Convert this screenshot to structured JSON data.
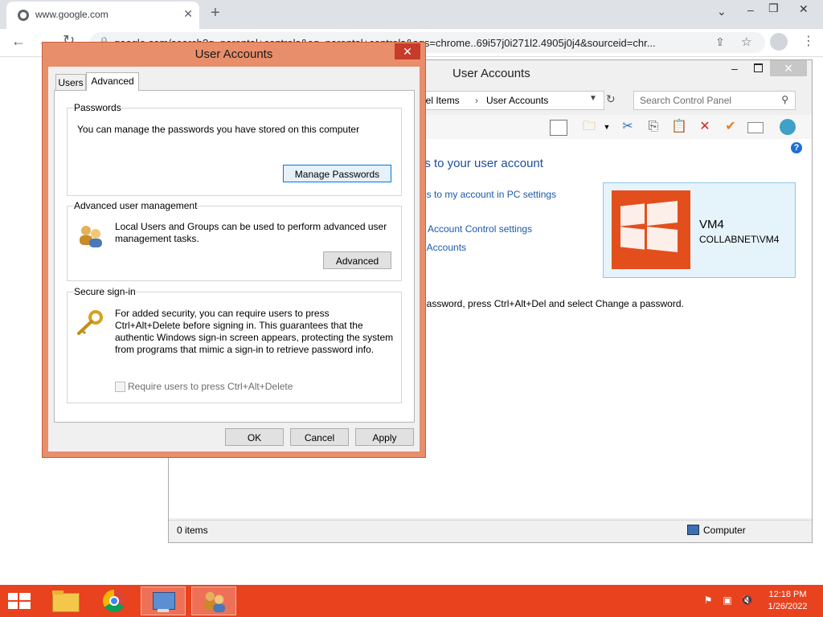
{
  "browser": {
    "tab_title": "www.google.com",
    "tab_close": "✕",
    "new_tab": "+",
    "url": "google.com/search?q=parental+controls&oq=parental+controls&aqs=chrome..69i57j0i271l2.4905j0j4&sourceid=chr...",
    "window_controls": {
      "minimize": "–",
      "restore": "❐",
      "close": "✕"
    },
    "chevron": "⌄",
    "icons": [
      "back-icon",
      "forward-icon",
      "reload-icon",
      "share-icon",
      "bookmark-star-icon",
      "profile-icon",
      "menu-icon"
    ]
  },
  "control_panel": {
    "title": "User Accounts",
    "close_glyph": "✕",
    "min_glyph": "–",
    "breadcrumb": [
      "nel Items",
      "User Accounts"
    ],
    "breadcrumb_sep": "›",
    "search_placeholder": "Search Control Panel",
    "help_glyph": "?",
    "heading": "es to your user account",
    "links": [
      "es to my account in PC settings",
      "Account Control settings",
      "r Accounts"
    ],
    "user": {
      "name": "VM4",
      "domain": "COLLABNET\\VM4"
    },
    "note": "password, press Ctrl+Alt+Del and select Change a password.",
    "status": {
      "items": "0 items",
      "location": "Computer"
    }
  },
  "dialog": {
    "title": "User Accounts",
    "close_glyph": "✕",
    "tabs": [
      {
        "label": "Users",
        "active": false
      },
      {
        "label": "Advanced",
        "active": true
      }
    ],
    "passwords": {
      "label": "Passwords",
      "text": "You can manage the passwords you have stored on this computer",
      "button": "Manage Passwords"
    },
    "advanced_mgmt": {
      "label": "Advanced user management",
      "text": "Local Users and Groups can be used to perform advanced user management tasks.",
      "button": "Advanced"
    },
    "secure_signin": {
      "label": "Secure sign-in",
      "text": "For added security, you can require users to press Ctrl+Alt+Delete before signing in. This guarantees that the authentic Windows sign-in screen appears, protecting the system from programs that mimic a sign-in to retrieve password info.",
      "checkbox_label": "Require users to press Ctrl+Alt+Delete",
      "checkbox_checked": false,
      "checkbox_enabled": false
    },
    "buttons": {
      "ok": "OK",
      "cancel": "Cancel",
      "apply": "Apply"
    }
  },
  "taskbar": {
    "apps": [
      "file-explorer-icon",
      "chrome-icon",
      "control-panel-icon",
      "user-accounts-icon"
    ],
    "active_app": "user-accounts-icon",
    "time": "12:18 PM",
    "date": "1/26/2022"
  },
  "colors": {
    "taskbar": "#e8421f",
    "dialog_frame": "#e88e6a",
    "link": "#1a5aa8",
    "user_tile": "#e24f1d"
  }
}
